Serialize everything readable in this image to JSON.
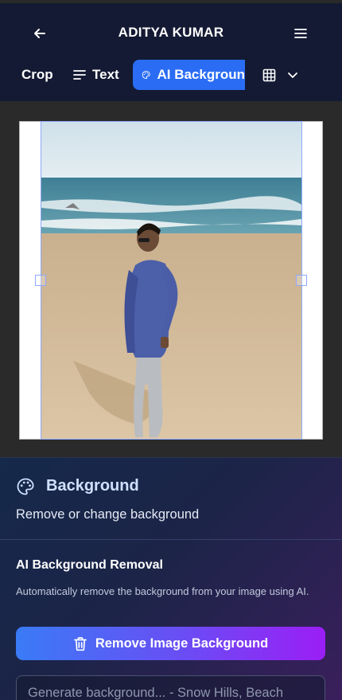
{
  "header": {
    "title": "ADITYA KUMAR",
    "back_icon": "arrow-left-icon",
    "menu_icon": "hamburger-menu-icon"
  },
  "toolbar": {
    "crop_label": "Crop",
    "text_label": "Text",
    "ai_background_label": "AI Backgroun",
    "active_color": "#2a6df4",
    "grid_icon": "grid-icon",
    "dropdown_icon": "chevron-down-icon"
  },
  "panel": {
    "title": "Background",
    "subtitle": "Remove or change background",
    "section_title": "AI Background Removal",
    "section_desc": "Automatically remove the background from your image using AI.",
    "remove_button_label": "Remove Image Background",
    "generate_placeholder": "Generate background... - Snow Hills, Beach"
  },
  "colors": {
    "header_bg": "#141a33",
    "canvas_bg": "#2a2a2a",
    "gradient_start": "#3a7bf6",
    "gradient_end": "#9b1ef5"
  }
}
